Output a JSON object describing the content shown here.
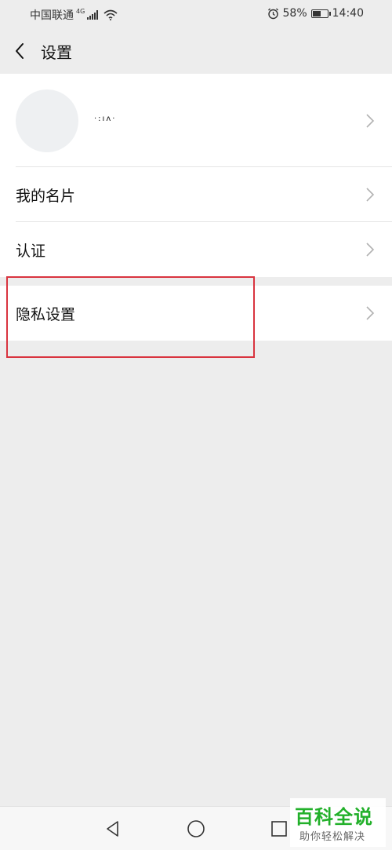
{
  "status_bar": {
    "carrier": "中国联通",
    "network": "4G",
    "battery": "58%",
    "battery_level": 0.58,
    "time": "14:40"
  },
  "header": {
    "back_icon": "back-arrow-icon",
    "title": "设置"
  },
  "profile": {
    "name": "·:ıʌ·"
  },
  "list_group_1": [
    {
      "label": "我的名片"
    },
    {
      "label": "认证"
    }
  ],
  "list_group_2": [
    {
      "label": "隐私设置"
    }
  ],
  "highlight_color": "#d9343f",
  "nav_bar": {
    "icons": [
      "back-triangle-icon",
      "home-circle-icon",
      "recents-square-icon"
    ]
  },
  "watermark": {
    "title": "百科全说",
    "subtitle": "助你轻松解决"
  }
}
